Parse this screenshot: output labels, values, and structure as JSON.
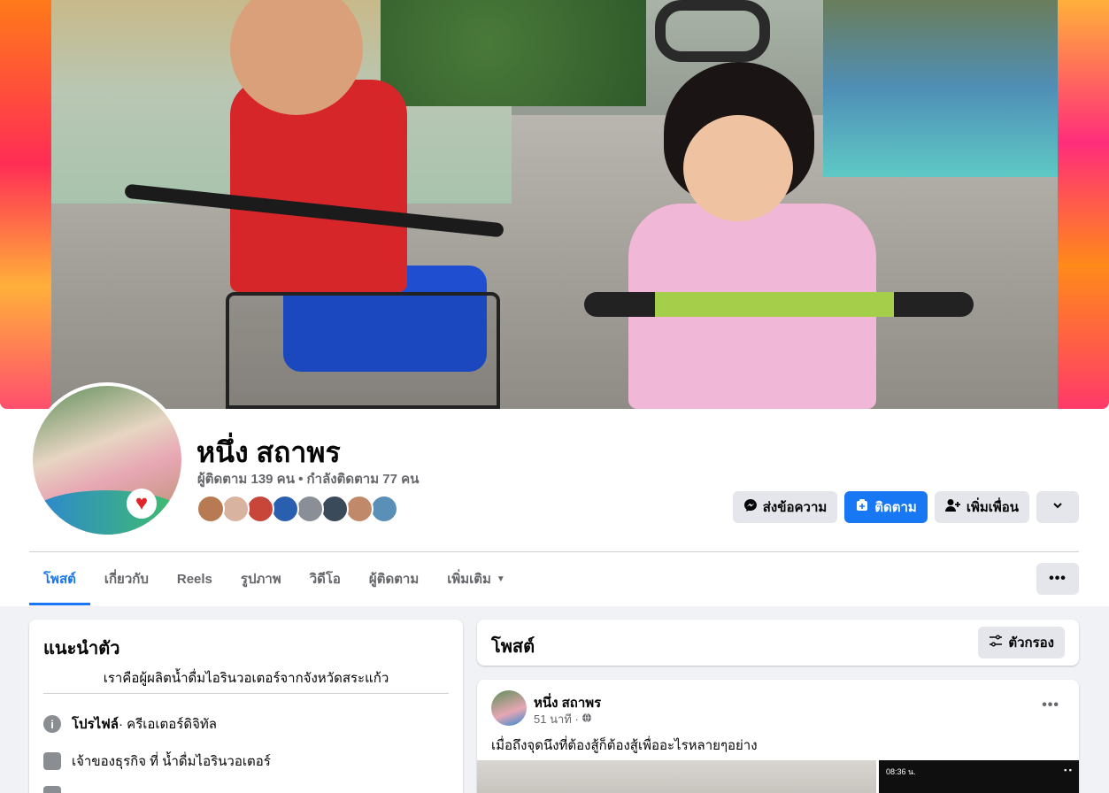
{
  "profile": {
    "name": "หนึ่ง สถาพร",
    "followers_line": "ผู้ติดตาม 139 คน • กำลังติดตาม 77 คน"
  },
  "friend_avatars": [
    "#b77a52",
    "#d7b3a0",
    "#c8453a",
    "#2a5fb0",
    "#8a8f97",
    "#3b4a5a",
    "#c08a6a",
    "#5a8fb8"
  ],
  "actions": {
    "message": "ส่งข้อความ",
    "follow": "ติดตาม",
    "add_friend": "เพิ่มเพื่อน"
  },
  "tabs": [
    {
      "label": "โพสต์"
    },
    {
      "label": "เกี่ยวกับ"
    },
    {
      "label": "Reels"
    },
    {
      "label": "รูปภาพ"
    },
    {
      "label": "วิดีโอ"
    },
    {
      "label": "ผู้ติดตาม"
    },
    {
      "label": "เพิ่มเติม"
    }
  ],
  "intro": {
    "title": "แนะนำตัว",
    "bio": "เราคือผู้ผลิตน้ำดื่มไอรินวอเตอร์จากจังหวัดสระแก้ว",
    "profile_label": "โปรไฟล์",
    "profile_type": " · ครีเอเตอร์ดิจิทัล",
    "business_owner": "เจ้าของธุรกิจ ที่ น้ำดื่มไอรินวอเตอร์"
  },
  "posts": {
    "title": "โพสต์",
    "filter_label": "ตัวกรอง",
    "post": {
      "author": "หนึ่ง สถาพร",
      "time": "51 นาที ·",
      "text": "เมื่อถึงจุดนึงที่ต้องสู้ก็ต้องสู้เพื่ออะไรหลายๆอย่าง",
      "phone_time": "08:36 น."
    }
  },
  "colors": {
    "accent": "#1877f2",
    "secondary_text": "#65676b",
    "button_bg": "#e4e6eb"
  }
}
